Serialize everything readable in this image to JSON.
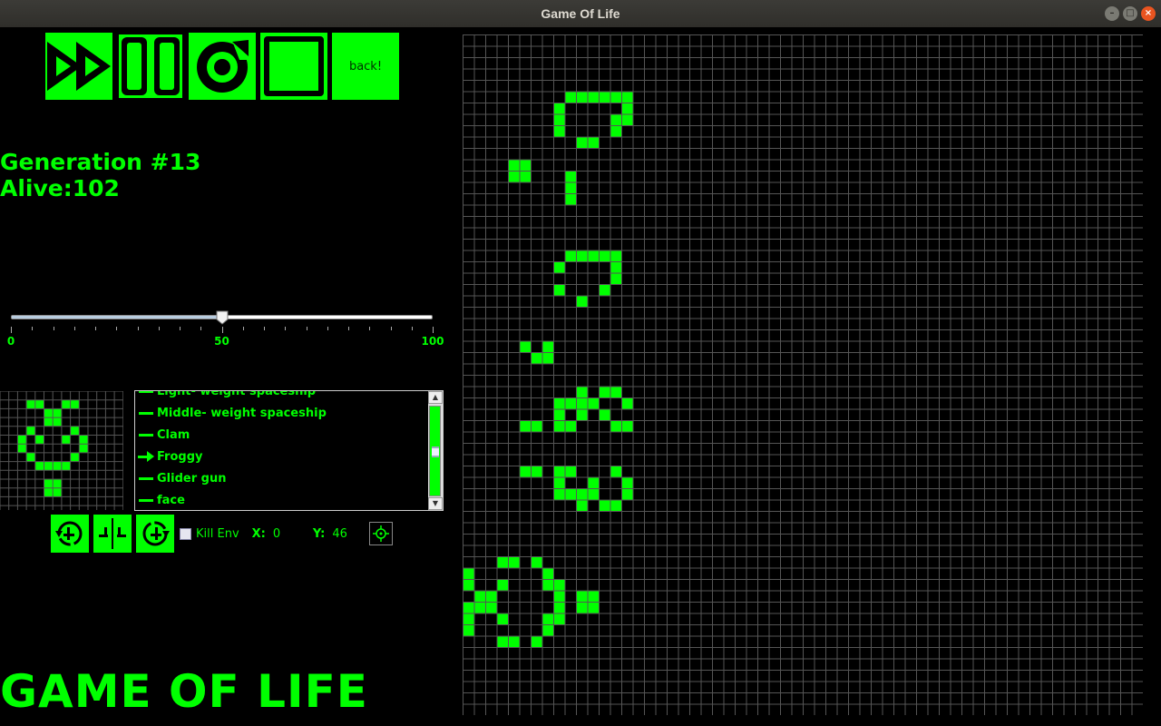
{
  "window": {
    "title": "Game Of Life",
    "minimize": "–",
    "maximize": "□",
    "close": "×"
  },
  "toolbar": {
    "back_label": "back!",
    "icons": [
      "play-fast-icon",
      "pause-icon",
      "reset-icon",
      "stop-icon"
    ]
  },
  "status": {
    "generation": "Generation #13",
    "alive": "Alive:102"
  },
  "speed_slider": {
    "min": 0,
    "max": 100,
    "value": 50,
    "labels": [
      "0",
      "50",
      "100"
    ]
  },
  "patterns": {
    "items": [
      {
        "label": "Light- weight spaceship",
        "marker": "dash"
      },
      {
        "label": "Middle- weight spaceship",
        "marker": "dash"
      },
      {
        "label": "Clam",
        "marker": "dash"
      },
      {
        "label": "Froggy",
        "marker": "arrow"
      },
      {
        "label": "Glider gun",
        "marker": "dash"
      },
      {
        "label": "face",
        "marker": "dash"
      }
    ],
    "selected": "Froggy",
    "preview_cells": [
      [
        3,
        1
      ],
      [
        4,
        1
      ],
      [
        7,
        1
      ],
      [
        8,
        1
      ],
      [
        5,
        2
      ],
      [
        6,
        2
      ],
      [
        5,
        3
      ],
      [
        6,
        3
      ],
      [
        3,
        4
      ],
      [
        8,
        4
      ],
      [
        2,
        5
      ],
      [
        4,
        5
      ],
      [
        7,
        5
      ],
      [
        9,
        5
      ],
      [
        2,
        6
      ],
      [
        9,
        6
      ],
      [
        3,
        7
      ],
      [
        8,
        7
      ],
      [
        4,
        8
      ],
      [
        5,
        8
      ],
      [
        6,
        8
      ],
      [
        7,
        8
      ],
      [
        5,
        10
      ],
      [
        6,
        10
      ],
      [
        5,
        11
      ],
      [
        6,
        11
      ]
    ]
  },
  "controls": {
    "kill_env_label": "Kill Env",
    "kill_env_checked": false,
    "x_label": "X:",
    "x_value": "0",
    "y_label": "Y:",
    "y_value": "46"
  },
  "app_title": "GAME OF LIFE",
  "board": {
    "cols": 60,
    "rows": 60,
    "live_cells": [
      [
        9,
        5
      ],
      [
        10,
        5
      ],
      [
        11,
        5
      ],
      [
        12,
        5
      ],
      [
        13,
        5
      ],
      [
        14,
        5
      ],
      [
        8,
        6
      ],
      [
        14,
        6
      ],
      [
        8,
        7
      ],
      [
        13,
        7
      ],
      [
        14,
        7
      ],
      [
        8,
        8
      ],
      [
        13,
        8
      ],
      [
        10,
        9
      ],
      [
        11,
        9
      ],
      [
        4,
        11
      ],
      [
        5,
        11
      ],
      [
        4,
        12
      ],
      [
        5,
        12
      ],
      [
        9,
        12
      ],
      [
        9,
        13
      ],
      [
        9,
        14
      ],
      [
        9,
        19
      ],
      [
        10,
        19
      ],
      [
        11,
        19
      ],
      [
        12,
        19
      ],
      [
        13,
        19
      ],
      [
        8,
        20
      ],
      [
        13,
        20
      ],
      [
        13,
        21
      ],
      [
        8,
        22
      ],
      [
        12,
        22
      ],
      [
        10,
        23
      ],
      [
        5,
        27
      ],
      [
        7,
        27
      ],
      [
        6,
        28
      ],
      [
        7,
        28
      ],
      [
        10,
        31
      ],
      [
        12,
        31
      ],
      [
        13,
        31
      ],
      [
        8,
        32
      ],
      [
        9,
        32
      ],
      [
        10,
        32
      ],
      [
        11,
        32
      ],
      [
        14,
        32
      ],
      [
        8,
        33
      ],
      [
        10,
        33
      ],
      [
        12,
        33
      ],
      [
        5,
        34
      ],
      [
        6,
        34
      ],
      [
        8,
        34
      ],
      [
        9,
        34
      ],
      [
        13,
        34
      ],
      [
        14,
        34
      ],
      [
        5,
        38
      ],
      [
        6,
        38
      ],
      [
        8,
        38
      ],
      [
        9,
        38
      ],
      [
        13,
        38
      ],
      [
        8,
        39
      ],
      [
        11,
        39
      ],
      [
        14,
        39
      ],
      [
        8,
        40
      ],
      [
        9,
        40
      ],
      [
        10,
        40
      ],
      [
        11,
        40
      ],
      [
        14,
        40
      ],
      [
        10,
        41
      ],
      [
        12,
        41
      ],
      [
        13,
        41
      ],
      [
        3,
        46
      ],
      [
        4,
        46
      ],
      [
        6,
        46
      ],
      [
        0,
        47
      ],
      [
        7,
        47
      ],
      [
        0,
        48
      ],
      [
        3,
        48
      ],
      [
        7,
        48
      ],
      [
        8,
        48
      ],
      [
        1,
        49
      ],
      [
        2,
        49
      ],
      [
        8,
        49
      ],
      [
        10,
        49
      ],
      [
        11,
        49
      ],
      [
        0,
        50
      ],
      [
        1,
        50
      ],
      [
        2,
        50
      ],
      [
        8,
        50
      ],
      [
        10,
        50
      ],
      [
        11,
        50
      ],
      [
        0,
        51
      ],
      [
        3,
        51
      ],
      [
        7,
        51
      ],
      [
        8,
        51
      ],
      [
        0,
        52
      ],
      [
        7,
        52
      ],
      [
        3,
        53
      ],
      [
        4,
        53
      ],
      [
        6,
        53
      ]
    ]
  }
}
